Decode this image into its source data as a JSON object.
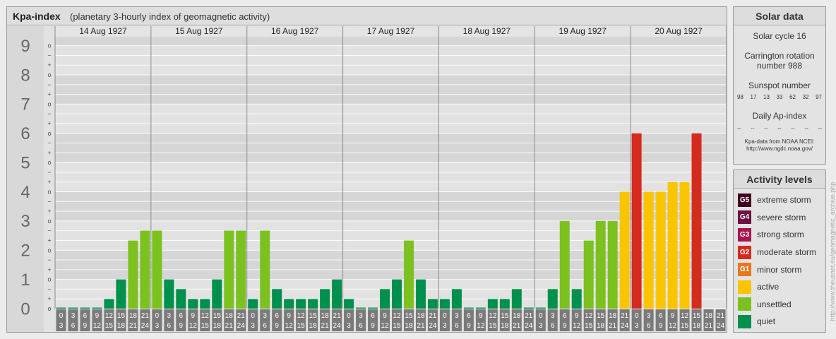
{
  "header": {
    "title": "Kpa-index",
    "subtitle": "(planetary 3-hourly index of geomagnetic activity)"
  },
  "chart_data": {
    "type": "bar",
    "days": [
      "14 Aug 1927",
      "15 Aug 1927",
      "16 Aug 1927",
      "17 Aug 1927",
      "18 Aug 1927",
      "19 Aug 1927",
      "20 Aug 1927"
    ],
    "interval_labels": [
      [
        "0",
        "3"
      ],
      [
        "3",
        "6"
      ],
      [
        "6",
        "9"
      ],
      [
        "9",
        "12"
      ],
      [
        "12",
        "15"
      ],
      [
        "15",
        "18"
      ],
      [
        "18",
        "21"
      ],
      [
        "21",
        "24"
      ]
    ],
    "y_ticks": [
      "0",
      "1",
      "2",
      "3",
      "4",
      "5",
      "6",
      "7",
      "8",
      "9"
    ],
    "minor_tick_symbols": [
      "−",
      "o",
      "+"
    ],
    "ylim": [
      0,
      9.33
    ],
    "values": [
      0.0,
      0.0,
      0.0,
      0.0,
      0.33,
      1.0,
      2.33,
      2.67,
      2.67,
      1.0,
      0.67,
      0.33,
      0.33,
      1.0,
      2.67,
      2.67,
      0.33,
      2.67,
      0.67,
      0.33,
      0.33,
      0.33,
      0.67,
      1.0,
      0.33,
      0.0,
      0.0,
      0.67,
      1.0,
      2.33,
      1.0,
      0.33,
      0.33,
      0.67,
      0.0,
      0.0,
      0.33,
      0.33,
      0.67,
      0.0,
      0.0,
      0.67,
      3.0,
      0.67,
      2.33,
      3.0,
      3.0,
      4.0,
      6.0,
      4.0,
      4.0,
      4.33,
      4.33,
      6.0
    ],
    "level_colors": {
      "quiet": "#00904d",
      "unsettled": "#7dc120",
      "active": "#fac400",
      "minor_storm": "#e8771f",
      "moderate_storm": "#d42b1e",
      "strong_storm": "#a81450",
      "severe_storm": "#6e1040",
      "extreme_storm": "#410020"
    },
    "grid": true
  },
  "solar": {
    "title": "Solar data",
    "cycle": "Solar cycle 16",
    "carrington_line1": "Carrington rotation",
    "carrington_line2": "number 988",
    "sunspot_title": "Sunspot number",
    "sunspots": [
      "98",
      "17",
      "13",
      "33",
      "62",
      "32",
      "97"
    ],
    "ap_title": "Daily Ap-index",
    "ap_values": [
      "--",
      "--",
      "--",
      "--",
      "--",
      "--",
      "--"
    ],
    "source_line1": "Kpa-data from NOAA NCEI:",
    "source_line2": "http://www.ngdc.noaa.gov/"
  },
  "activity": {
    "title": "Activity levels",
    "items": [
      {
        "code": "G5",
        "label": "extreme storm",
        "color": "#410020"
      },
      {
        "code": "G4",
        "label": "severe storm",
        "color": "#6e1040"
      },
      {
        "code": "G3",
        "label": "strong storm",
        "color": "#a81450"
      },
      {
        "code": "G2",
        "label": "moderate storm",
        "color": "#d42b1e"
      },
      {
        "code": "G1",
        "label": "minor storm",
        "color": "#e8771f"
      },
      {
        "code": "",
        "label": "active",
        "color": "#fac400"
      },
      {
        "code": "",
        "label": "unsettled",
        "color": "#7dc120"
      },
      {
        "code": "",
        "label": "quiet",
        "color": "#00904d"
      }
    ]
  },
  "footer_url": "http://www.theusnet.eu/geomagnetic_archive.php"
}
